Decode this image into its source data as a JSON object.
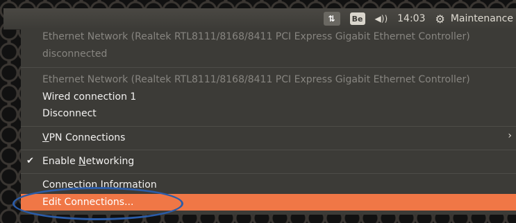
{
  "panel": {
    "keyboard_layout": "Be",
    "clock": "14:03",
    "user": "Maintenance",
    "icons": [
      "network-icon",
      "volume-icon",
      "power-icon"
    ]
  },
  "menu": {
    "ethernet1_header": "Ethernet Network (Realtek RTL8111/8168/8411 PCI Express Gigabit Ethernet Controller)",
    "ethernet1_status": "disconnected",
    "ethernet2_header": "Ethernet Network (Realtek RTL8111/8168/8411 PCI Express Gigabit Ethernet Controller)",
    "wired_connection": "Wired connection 1",
    "disconnect": "Disconnect",
    "vpn_mnemonic": "V",
    "vpn_rest": "PN Connections",
    "enable_prefix": "Enable ",
    "enable_mnemonic": "N",
    "enable_rest": "etworking",
    "connection_information": "Connection Information",
    "edit_connections": "Edit Connections..."
  },
  "colors": {
    "menu_bg": "#3c3b37",
    "highlight": "#f07746",
    "annotation": "#2b5ca8"
  }
}
